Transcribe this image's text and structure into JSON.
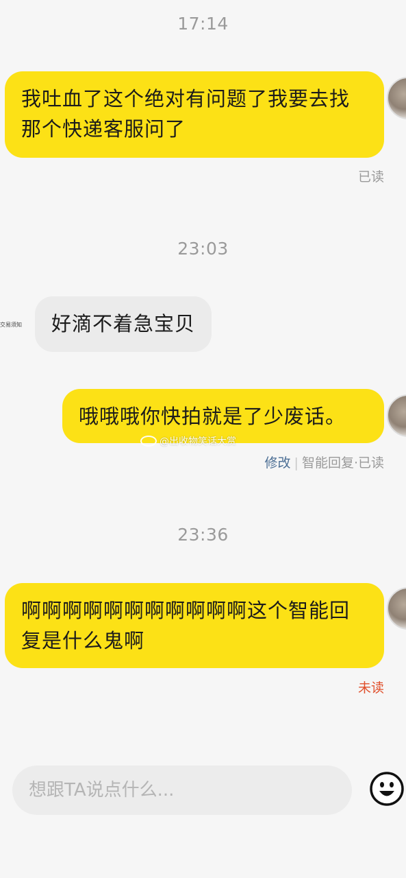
{
  "messages": [
    {
      "type": "time",
      "text": "17:14"
    },
    {
      "type": "me",
      "text": "我吐血了这个绝对有问题了我要去找那个快递客服问了",
      "status": "已读"
    },
    {
      "type": "time",
      "text": "23:03"
    },
    {
      "type": "them",
      "text": "好滴不着急宝贝",
      "side_caption": "交易须知"
    },
    {
      "type": "me",
      "text": "哦哦哦你快拍就是了少废话。",
      "status_edit": "修改",
      "status_rest": "智能回复·已读"
    },
    {
      "type": "time",
      "text": "23:36"
    },
    {
      "type": "me",
      "text": "啊啊啊啊啊啊啊啊啊啊啊这个智能回复是什么鬼啊",
      "status": "未读"
    }
  ],
  "watermark": "@出收物笑话大赏",
  "input": {
    "placeholder": "想跟TA说点什么..."
  },
  "icons": {
    "emoji": "smiley-face-icon",
    "avatar": "user-avatar"
  },
  "colors": {
    "my_bubble": "#fce116",
    "their_bubble": "#ebebeb",
    "unread": "#e0502c",
    "edit_link": "#4b6e94"
  }
}
